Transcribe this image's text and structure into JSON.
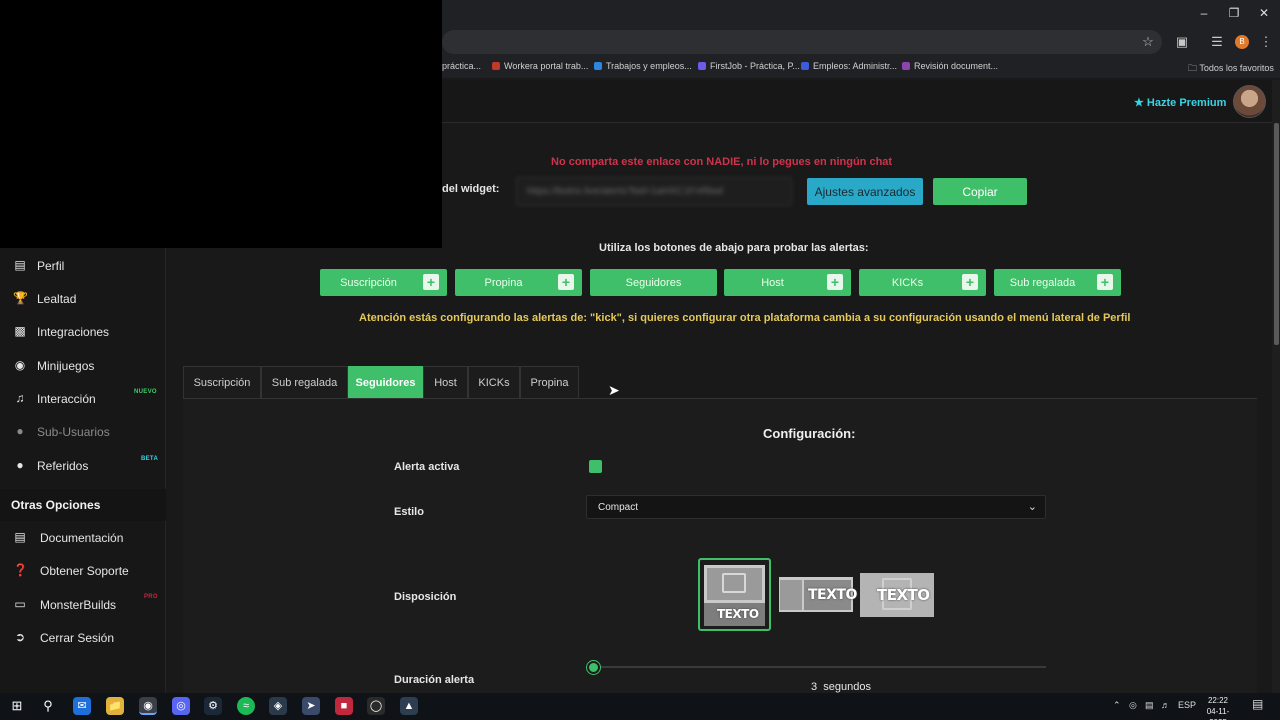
{
  "browser": {
    "bookmarks": [
      {
        "label": "práctica...",
        "color": "#555555"
      },
      {
        "label": "Workera portal trab...",
        "color": "#c0392b"
      },
      {
        "label": "Trabajos y empleos...",
        "color": "#2e86de"
      },
      {
        "label": "FirstJob - Práctica, P...",
        "color": "#6c5ce7"
      },
      {
        "label": "Empleos: Administr...",
        "color": "#3b5bdb"
      },
      {
        "label": "Revisión document...",
        "color": "#8e44ad"
      }
    ],
    "all_bookmarks": "Todos los favoritos",
    "profile_initial": "B"
  },
  "header": {
    "premium_label": "Hazte Premium"
  },
  "sidebar": {
    "items": [
      {
        "label": "Perfil",
        "icon": "id-card-icon"
      },
      {
        "label": "Lealtad",
        "icon": "trophy-icon"
      },
      {
        "label": "Integraciones",
        "icon": "puzzle-icon"
      },
      {
        "label": "Minijuegos",
        "icon": "gamepad-icon"
      },
      {
        "label": "Interacción",
        "icon": "music-note-icon",
        "badge": "NUEVO"
      },
      {
        "label": "Sub-Usuarios",
        "icon": "users-icon"
      },
      {
        "label": "Referidos",
        "icon": "user-friends-icon",
        "badge": "BETA"
      }
    ],
    "section_title": "Otras Opciones",
    "other_items": [
      {
        "label": "Documentación",
        "icon": "book-icon"
      },
      {
        "label": "Obtener Soporte",
        "icon": "help-icon"
      },
      {
        "label": "MonsterBuilds",
        "icon": "laptop-icon",
        "badge": "PRO"
      },
      {
        "label": "Cerrar Sesión",
        "icon": "logout-icon"
      }
    ]
  },
  "widget": {
    "warning": "No comparta este enlace con NADIE, ni lo pegues en ningún chat",
    "url_label": "del widget:",
    "url_value": "https://botrix.live/alerts?bid=1aHXC1FnRbwl",
    "advanced_button": "Ajustes avanzados",
    "copy_button": "Copiar"
  },
  "test": {
    "title": "Utiliza los botones de abajo para probar las alertas:",
    "buttons": [
      {
        "label": "Suscripción",
        "plus": "+"
      },
      {
        "label": "Propina",
        "plus": "+"
      },
      {
        "label": "Seguidores",
        "plus": ""
      },
      {
        "label": "Host",
        "plus": "+"
      },
      {
        "label": "KICKs",
        "plus": "+"
      },
      {
        "label": "Sub regalada",
        "plus": "+"
      }
    ],
    "attention": "Atención estás configurando las alertas de: \"kick\", si quieres configurar otra plataforma cambia a su configuración usando el menú lateral de Perfil"
  },
  "tabs": [
    {
      "label": "Suscripción",
      "active": false
    },
    {
      "label": "Sub regalada",
      "active": false
    },
    {
      "label": "Seguidores",
      "active": true
    },
    {
      "label": "Host",
      "active": false
    },
    {
      "label": "KICKs",
      "active": false
    },
    {
      "label": "Propina",
      "active": false
    }
  ],
  "config": {
    "title": "Configuración:",
    "alert_active_label": "Alerta activa",
    "alert_active": true,
    "style_label": "Estilo",
    "style_value": "Compact",
    "layout_label": "Disposición",
    "layout_text": "TEXTO",
    "selected_layout_index": 0,
    "duration_label": "Duración alerta",
    "duration_value": "3",
    "duration_unit": "segundos"
  },
  "taskbar": {
    "language": "ESP",
    "time": "22:22",
    "date": "04-11-2025"
  },
  "colors": {
    "accent_green": "#3fbf6a",
    "accent_cyan": "#2aa8c8",
    "warning_red": "#d0324a",
    "attention_yellow": "#e4c95a"
  }
}
